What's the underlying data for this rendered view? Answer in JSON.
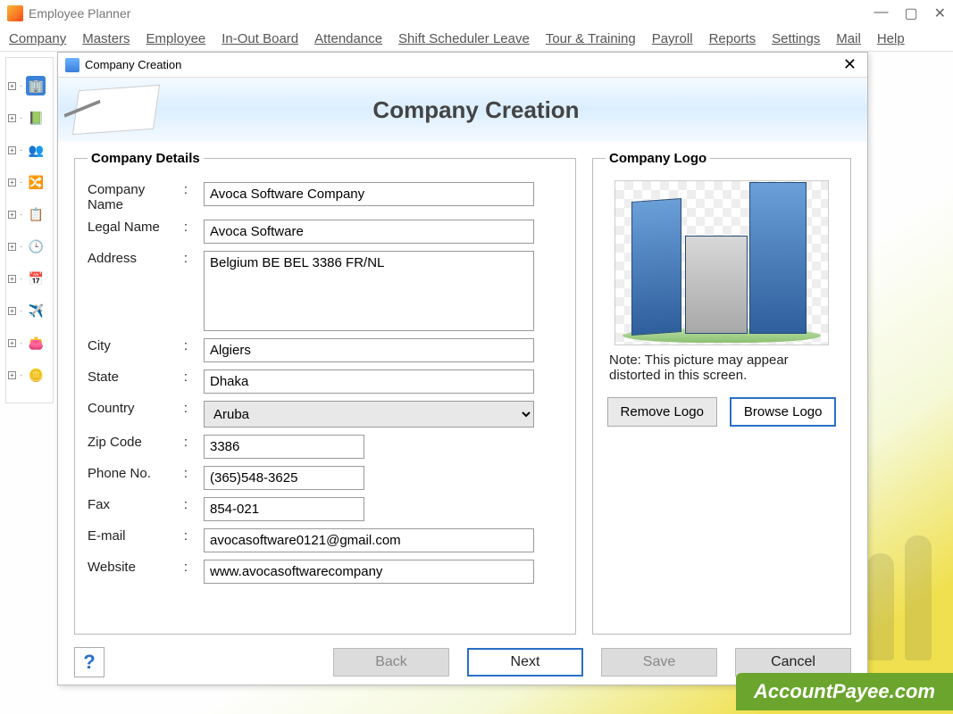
{
  "app": {
    "title": "Employee Planner"
  },
  "menu": {
    "items": [
      "Company",
      "Masters",
      "Employee",
      "In-Out Board",
      "Attendance",
      "Shift Scheduler Leave",
      "Tour & Training",
      "Payroll",
      "Reports",
      "Settings",
      "Mail",
      "Help"
    ]
  },
  "dialog": {
    "title": "Company Creation",
    "banner_title": "Company Creation",
    "details_legend": "Company Details",
    "logo_legend": "Company Logo",
    "labels": {
      "company_name": "Company Name",
      "legal_name": "Legal Name",
      "address": "Address",
      "city": "City",
      "state": "State",
      "country": "Country",
      "zip": "Zip Code",
      "phone": "Phone No.",
      "fax": "Fax",
      "email": "E-mail",
      "website": "Website"
    },
    "values": {
      "company_name": "Avoca Software Company",
      "legal_name": "Avoca Software",
      "address": "Belgium BE BEL 3386 FR/NL",
      "city": "Algiers",
      "state": "Dhaka",
      "country": "Aruba",
      "zip": "3386",
      "phone": "(365)548-3625",
      "fax": "854-021",
      "email": "avocasoftware0121@gmail.com",
      "website": "www.avocasoftwarecompany"
    },
    "logo_note": "Note: This picture may appear distorted in this screen.",
    "buttons": {
      "remove_logo": "Remove Logo",
      "browse_logo": "Browse Logo",
      "back": "Back",
      "next": "Next",
      "save": "Save",
      "cancel": "Cancel"
    }
  },
  "watermark": "AccountPayee.com"
}
